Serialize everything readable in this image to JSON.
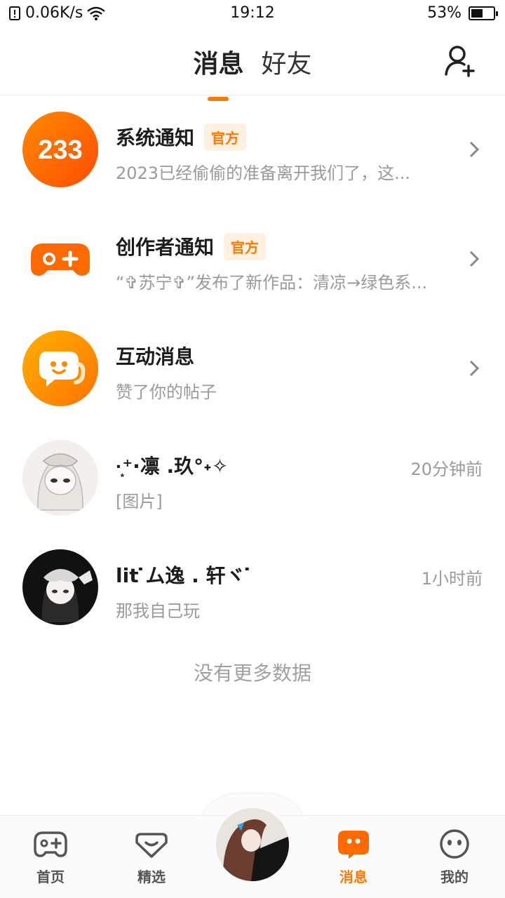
{
  "status_bar": {
    "speed": "0.06K/s",
    "time": "19:12",
    "battery": "53%",
    "battery_level": 0.53
  },
  "header": {
    "tabs": [
      {
        "label": "消息",
        "active": true
      },
      {
        "label": "好友",
        "active": false
      }
    ],
    "add_friend_icon": "person-add-icon"
  },
  "messages": [
    {
      "title": "系统通知",
      "badge": "官方",
      "subtitle": "2023已经偷偷的准备离开我们了，这...",
      "avatar_text": "233",
      "avatar_icon": "logo-233-icon"
    },
    {
      "title": "创作者通知",
      "badge": "官方",
      "subtitle": "“✞苏宁✞”发布了新作品：清凉→绿色系...",
      "avatar_icon": "gamepad-icon"
    },
    {
      "title": "互动消息",
      "subtitle": "赞了你的帖子",
      "avatar_icon": "chat-bubble-icon"
    },
    {
      "title": "·͙⁺·凛 .玖°˖✧",
      "subtitle": "[图片]",
      "time": "20分钟前",
      "avatar_icon": "user-avatar"
    },
    {
      "title": "lit ̇ム逸 . 轩ヾ ̇",
      "subtitle": "那我自己玩",
      "time": "1小时前",
      "avatar_icon": "user-avatar"
    }
  ],
  "no_more": "没有更多数据",
  "bottom_nav": [
    {
      "label": "首页",
      "icon": "gamepad-icon"
    },
    {
      "label": "精选",
      "icon": "heart-box-icon"
    },
    {
      "label": "消息",
      "icon": "chat-icon",
      "active": true
    },
    {
      "label": "我的",
      "icon": "face-icon"
    }
  ],
  "colors": {
    "accent": "#ff7a00",
    "muted": "#9a9a9a"
  }
}
